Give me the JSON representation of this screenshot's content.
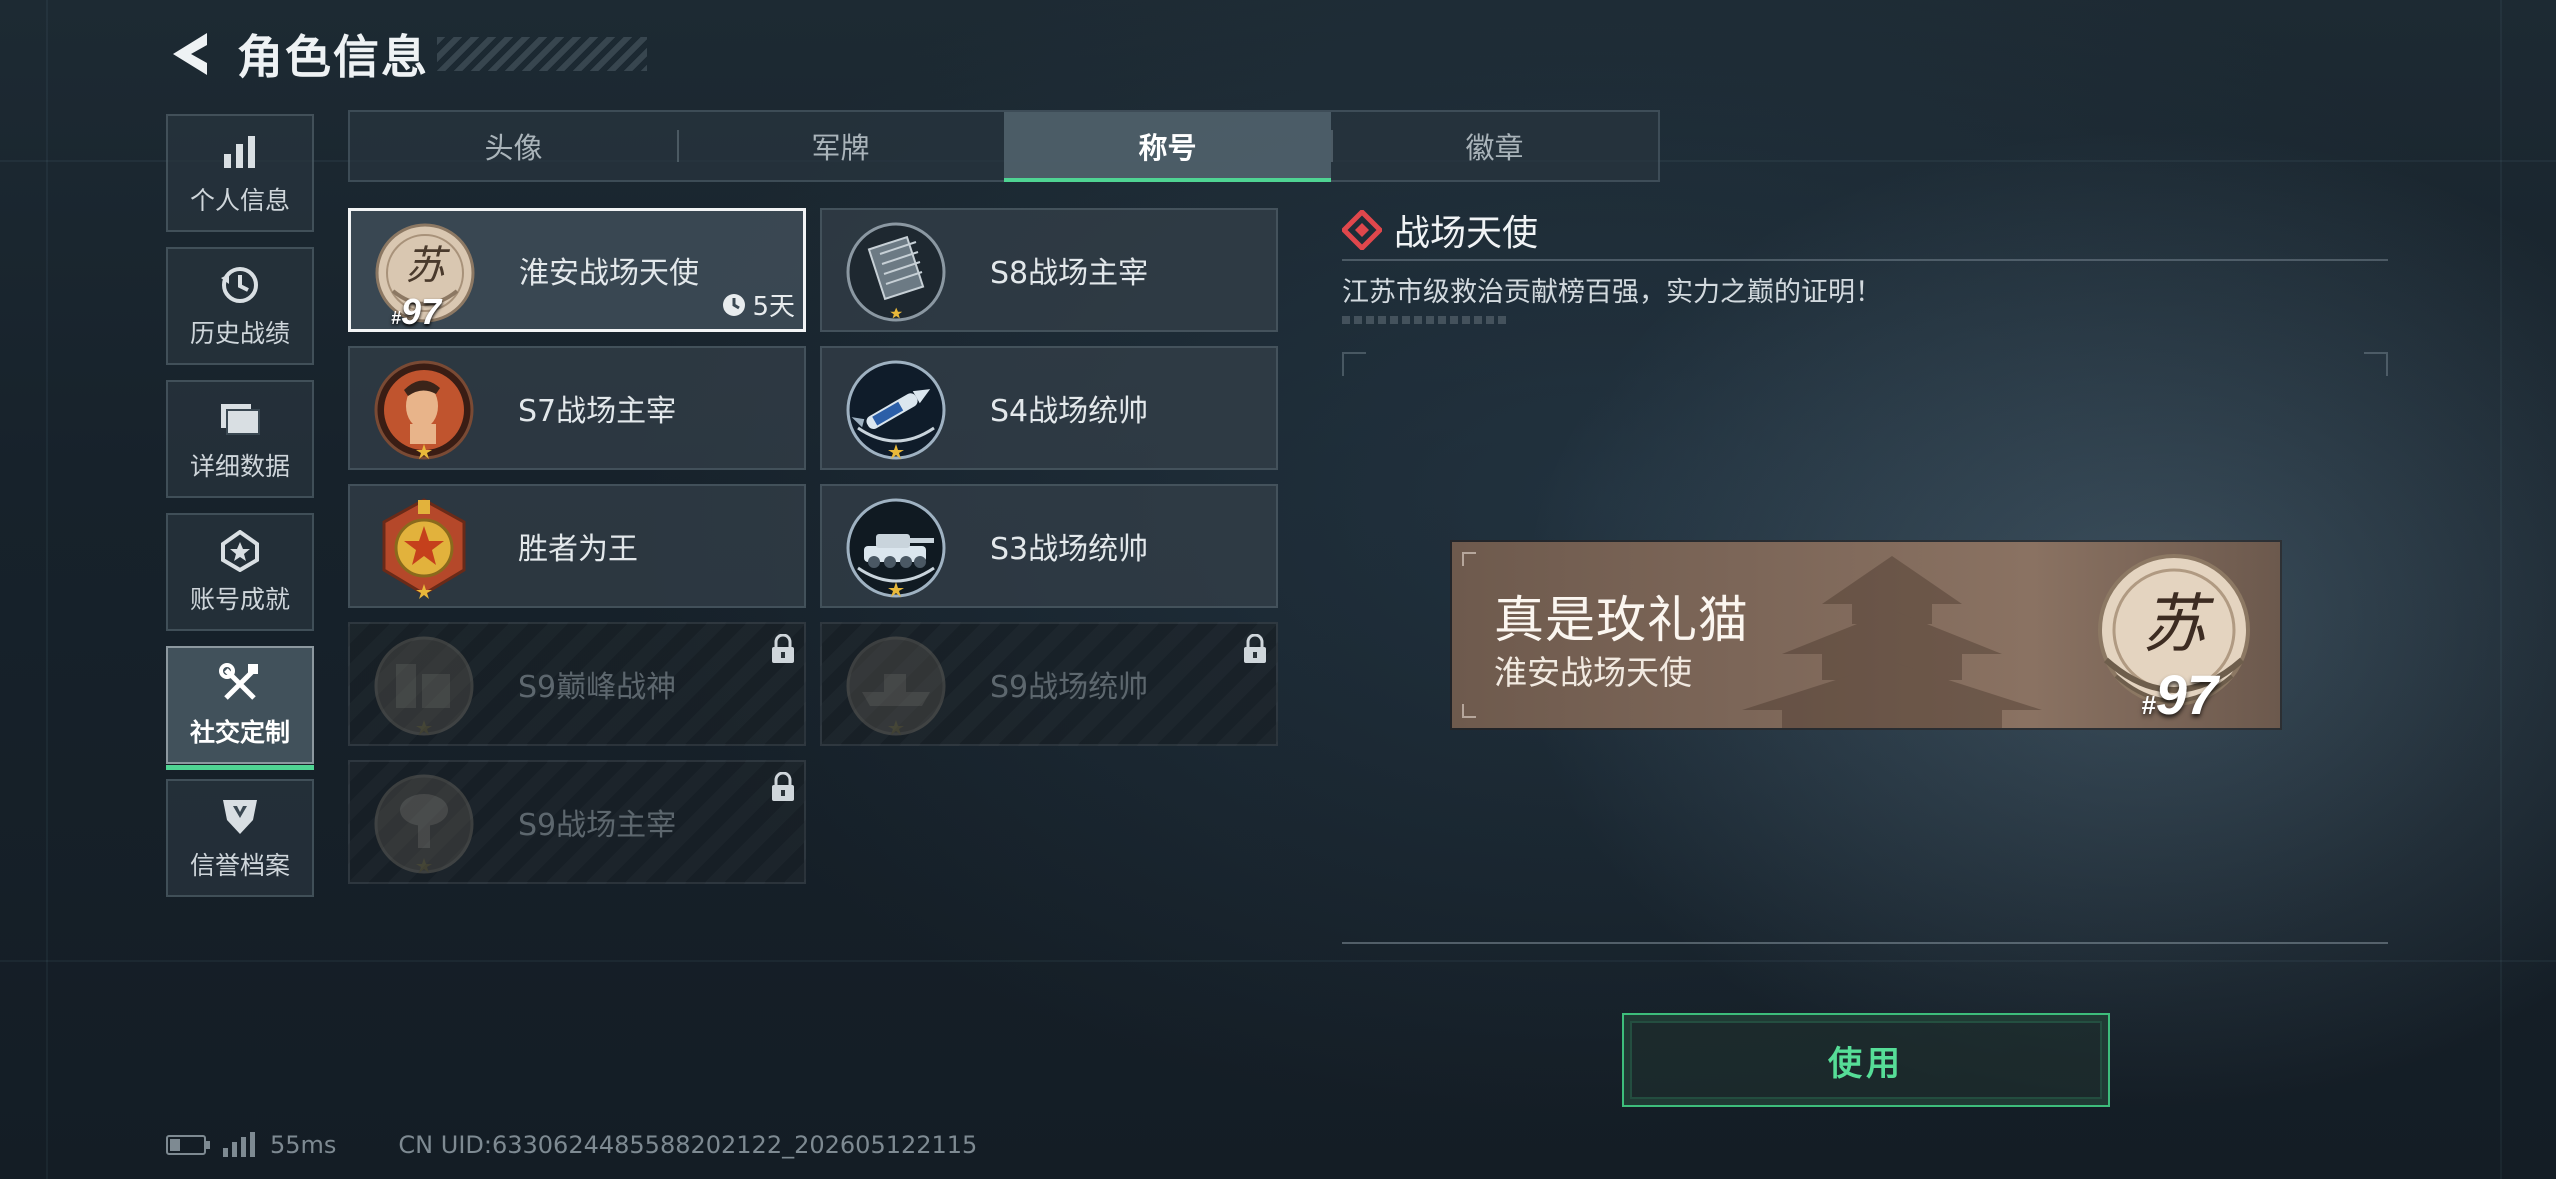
{
  "header": {
    "title": "角色信息"
  },
  "nav": [
    {
      "label": "个人信息",
      "icon": "bar-chart-icon"
    },
    {
      "label": "历史战绩",
      "icon": "history-clock-icon"
    },
    {
      "label": "详细数据",
      "icon": "folder-icon"
    },
    {
      "label": "账号成就",
      "icon": "achievement-medal-icon"
    },
    {
      "label": "社交定制",
      "icon": "tools-icon",
      "active": true
    },
    {
      "label": "信誉档案",
      "icon": "shield-emblem-icon"
    }
  ],
  "tabs": [
    {
      "label": "头像"
    },
    {
      "label": "军牌"
    },
    {
      "label": "称号",
      "active": true
    },
    {
      "label": "徽章"
    }
  ],
  "cards": [
    {
      "label": "淮安战场天使",
      "rank": "97",
      "rank_prefix": "#",
      "duration": "5天",
      "selected": true,
      "locked": false,
      "icon": "su-regional-medal-icon"
    },
    {
      "label": "S8战场主宰",
      "locked": false,
      "icon": "grid-building-medal-icon"
    },
    {
      "label": "S7战场主宰",
      "locked": false,
      "icon": "soldier-portrait-medal-icon"
    },
    {
      "label": "S4战场统帅",
      "locked": false,
      "icon": "missile-medal-icon"
    },
    {
      "label": "胜者为王",
      "locked": false,
      "icon": "gold-star-medal-icon"
    },
    {
      "label": "S3战场统帅",
      "locked": false,
      "icon": "tank-medal-icon"
    },
    {
      "label": "S9巅峰战神",
      "locked": true,
      "icon": "ruins-medal-icon"
    },
    {
      "label": "S9战场统帅",
      "locked": true,
      "icon": "warship-medal-icon"
    },
    {
      "label": "S9战场主宰",
      "locked": true,
      "icon": "mushroom-cloud-medal-icon"
    }
  ],
  "detail": {
    "title": "战场天使",
    "description": "江苏市级救治贡献榜百强，实力之巅的证明！"
  },
  "nameplate": {
    "player_name": "真是玫礼猫",
    "title": "淮安战场天使",
    "rank": "97",
    "rank_prefix": "#",
    "emblem_char": "苏"
  },
  "use_button": {
    "label": "使用"
  },
  "status": {
    "ping": "55ms",
    "uid": "CN UID:6330624485588202122_202605122115"
  },
  "colors": {
    "accent_green": "#4fd493",
    "card_border_selected": "#f2f4f5",
    "nameplate_bg": "#7c6658",
    "detail_diamond": "#e0474c"
  }
}
